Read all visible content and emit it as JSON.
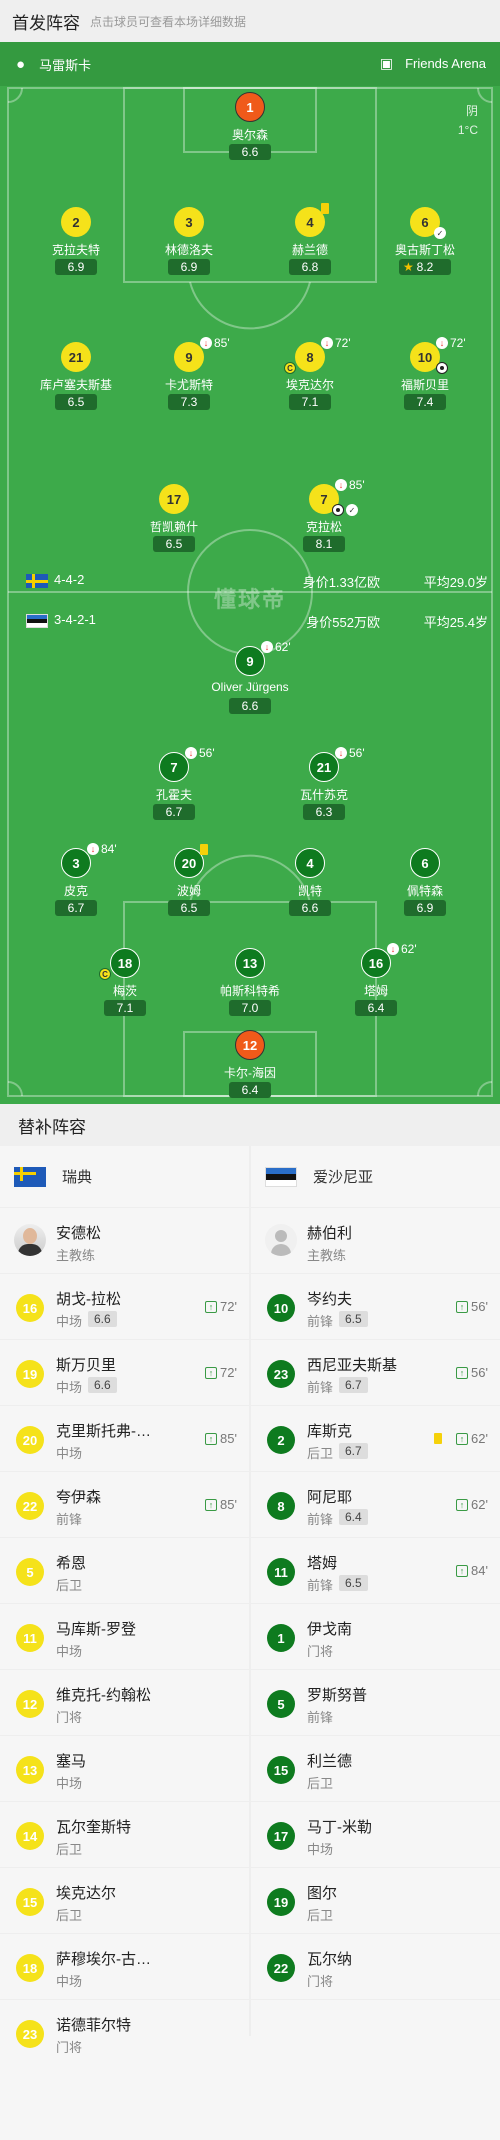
{
  "header": {
    "title": "首发阵容",
    "subtitle": "点击球员可查看本场详细数据"
  },
  "pitch": {
    "home_team": "马雷斯卡",
    "venue": "Friends Arena",
    "weather": "阴",
    "temperature": "1°C",
    "watermark": "懂球帝"
  },
  "home_info": {
    "formation": "4-4-2",
    "value": "身价1.33亿欧",
    "age": "平均29.0岁"
  },
  "away_info": {
    "formation": "3-4-2-1",
    "value": "身价552万欧",
    "age": "平均25.4岁"
  },
  "home_players": [
    {
      "num": "1",
      "name": "奥尔森",
      "rating": "6.6"
    },
    {
      "num": "2",
      "name": "克拉夫特",
      "rating": "6.9"
    },
    {
      "num": "3",
      "name": "林德洛夫",
      "rating": "6.9"
    },
    {
      "num": "4",
      "name": "赫兰德",
      "rating": "6.8"
    },
    {
      "num": "6",
      "name": "奥古斯丁松",
      "rating": "8.2"
    },
    {
      "num": "21",
      "name": "库卢塞夫斯基",
      "rating": "6.5"
    },
    {
      "num": "9",
      "name": "卡尤斯特",
      "rating": "7.3",
      "sub": "85'"
    },
    {
      "num": "8",
      "name": "埃克达尔",
      "rating": "7.1",
      "sub": "72'"
    },
    {
      "num": "10",
      "name": "福斯贝里",
      "rating": "7.4",
      "sub": "72'"
    },
    {
      "num": "17",
      "name": "哲凯赖什",
      "rating": "6.5"
    },
    {
      "num": "7",
      "name": "克拉松",
      "rating": "8.1",
      "sub": "85'"
    }
  ],
  "away_players": [
    {
      "num": "9",
      "name": "Oliver Jürgens",
      "rating": "6.6",
      "sub": "62'"
    },
    {
      "num": "7",
      "name": "孔霍夫",
      "rating": "6.7",
      "sub": "56'"
    },
    {
      "num": "21",
      "name": "瓦什苏克",
      "rating": "6.3",
      "sub": "56'"
    },
    {
      "num": "3",
      "name": "皮克",
      "rating": "6.7",
      "sub": "84'"
    },
    {
      "num": "20",
      "name": "波姆",
      "rating": "6.5"
    },
    {
      "num": "4",
      "name": "凯特",
      "rating": "6.6"
    },
    {
      "num": "6",
      "name": "佩特森",
      "rating": "6.9"
    },
    {
      "num": "18",
      "name": "梅茨",
      "rating": "7.1"
    },
    {
      "num": "13",
      "name": "帕斯科特希",
      "rating": "7.0"
    },
    {
      "num": "16",
      "name": "塔姆",
      "rating": "6.4",
      "sub": "62'"
    },
    {
      "num": "12",
      "name": "卡尔-海因",
      "rating": "6.4"
    }
  ],
  "subs_section": {
    "title": "替补阵容"
  },
  "home_bench": {
    "country": "瑞典",
    "coach": {
      "name": "安德松",
      "role": "主教练"
    },
    "players": [
      {
        "num": "16",
        "name": "胡戈-拉松",
        "pos": "中场",
        "rating": "6.6",
        "sub": "72'"
      },
      {
        "num": "19",
        "name": "斯万贝里",
        "pos": "中场",
        "rating": "6.6",
        "sub": "72'"
      },
      {
        "num": "20",
        "name": "克里斯托弗-…",
        "pos": "中场",
        "sub": "85'"
      },
      {
        "num": "22",
        "name": "夸伊森",
        "pos": "前锋",
        "sub": "85'"
      },
      {
        "num": "5",
        "name": "希恩",
        "pos": "后卫"
      },
      {
        "num": "11",
        "name": "马库斯-罗登",
        "pos": "中场"
      },
      {
        "num": "12",
        "name": "维克托-约翰松",
        "pos": "门将"
      },
      {
        "num": "13",
        "name": "塞马",
        "pos": "中场"
      },
      {
        "num": "14",
        "name": "瓦尔奎斯特",
        "pos": "后卫"
      },
      {
        "num": "15",
        "name": "埃克达尔",
        "pos": "后卫"
      },
      {
        "num": "18",
        "name": "萨穆埃尔-古…",
        "pos": "中场"
      },
      {
        "num": "23",
        "name": "诺德菲尔特",
        "pos": "门将"
      }
    ]
  },
  "away_bench": {
    "country": "爱沙尼亚",
    "coach": {
      "name": "赫伯利",
      "role": "主教练"
    },
    "players": [
      {
        "num": "10",
        "name": "岑约夫",
        "pos": "前锋",
        "rating": "6.5",
        "sub": "56'"
      },
      {
        "num": "23",
        "name": "西尼亚夫斯基",
        "pos": "前锋",
        "rating": "6.7",
        "sub": "56'"
      },
      {
        "num": "2",
        "name": "库斯克",
        "pos": "后卫",
        "rating": "6.7",
        "sub": "62'"
      },
      {
        "num": "8",
        "name": "阿尼耶",
        "pos": "前锋",
        "rating": "6.4",
        "sub": "62'"
      },
      {
        "num": "11",
        "name": "塔姆",
        "pos": "前锋",
        "rating": "6.5",
        "sub": "84'"
      },
      {
        "num": "1",
        "name": "伊戈南",
        "pos": "门将"
      },
      {
        "num": "5",
        "name": "罗斯努普",
        "pos": "前锋"
      },
      {
        "num": "15",
        "name": "利兰德",
        "pos": "后卫"
      },
      {
        "num": "17",
        "name": "马丁-米勒",
        "pos": "中场"
      },
      {
        "num": "19",
        "name": "图尔",
        "pos": "后卫"
      },
      {
        "num": "22",
        "name": "瓦尔纳",
        "pos": "门将"
      }
    ]
  },
  "colors": {
    "pitch": "#3daa4a",
    "home": "#f5e21a",
    "away": "#0e7b1f",
    "goalkeeper": "#f05a1a",
    "rating_bg": "#1f6c2c"
  }
}
